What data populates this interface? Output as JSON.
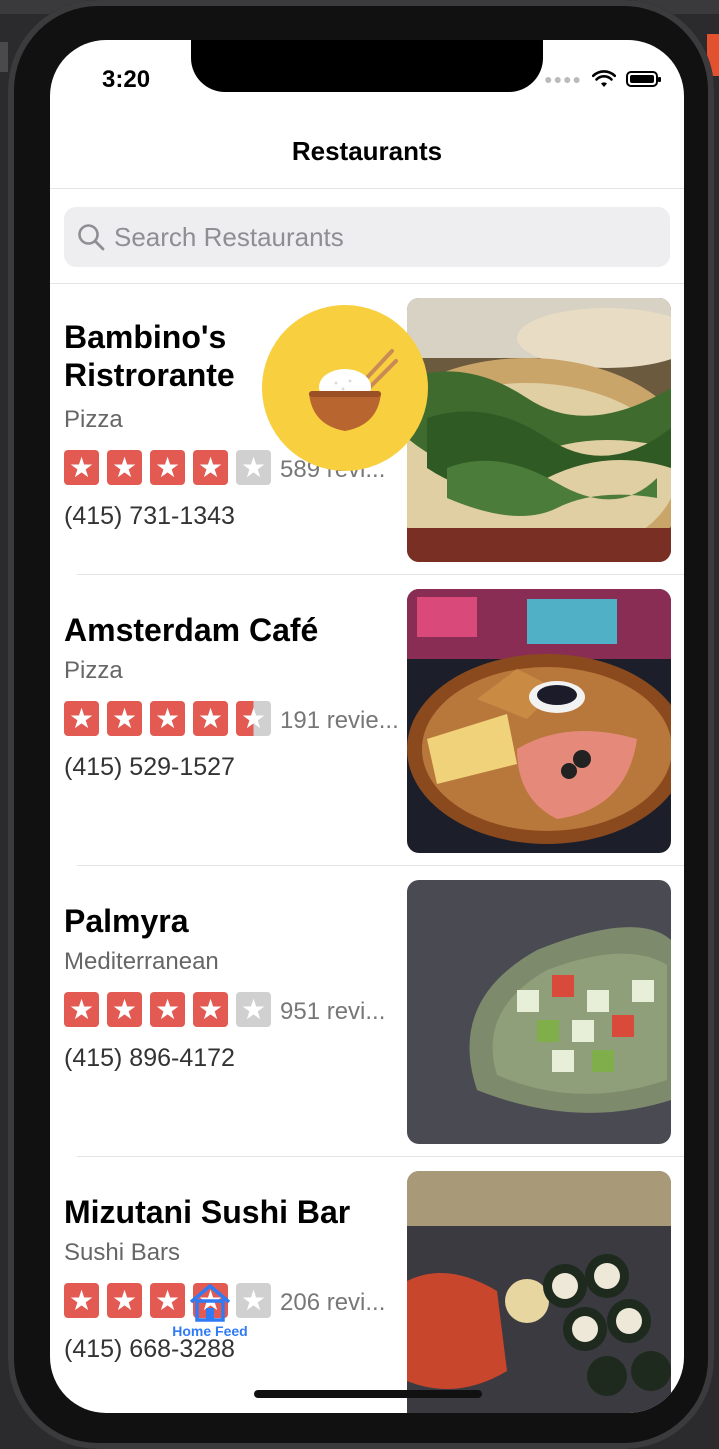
{
  "status_bar": {
    "time": "3:20"
  },
  "nav": {
    "title": "Restaurants"
  },
  "search": {
    "placeholder": "Search Restaurants"
  },
  "restaurants": [
    {
      "name": "Bambino's Ristrorante",
      "category": "Pizza",
      "rating": 4,
      "reviews": "589 revi...",
      "phone": "(415) 731-1343"
    },
    {
      "name": "Amsterdam Café",
      "category": "Pizza",
      "rating": 4.5,
      "reviews": "191 revie...",
      "phone": "(415) 529-1527"
    },
    {
      "name": "Palmyra",
      "category": "Mediterranean",
      "rating": 4,
      "reviews": "951 revi...",
      "phone": "(415) 896-4172"
    },
    {
      "name": "Mizutani Sushi Bar",
      "category": "Sushi Bars",
      "rating": 4,
      "reviews": "206 revi...",
      "phone": "(415) 668-3288"
    }
  ],
  "tab_bar": {
    "home_label": "Home Feed"
  },
  "colors": {
    "star_on": "#e25a52",
    "star_off": "#d0d0d0",
    "fab": "#f7cf3f",
    "tab_accent": "#2f7bf5"
  }
}
